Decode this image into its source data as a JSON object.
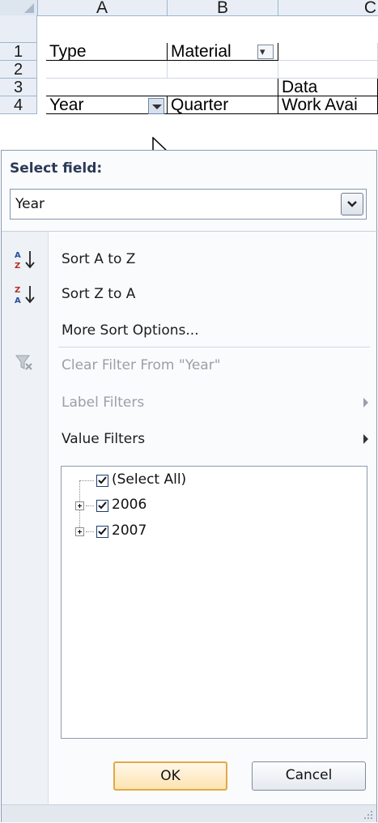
{
  "sheet": {
    "columns": [
      "A",
      "B",
      "C"
    ],
    "rows": [
      "1",
      "2",
      "3",
      "4"
    ],
    "cells": {
      "a1": "Type",
      "b1": "Material",
      "c3": "Data",
      "a4": "Year",
      "b4": "Quarter",
      "c4": "Work Avai"
    }
  },
  "popup": {
    "select_label": "Select field:",
    "select_value": "Year",
    "menu": {
      "sort_az": "Sort A to Z",
      "sort_za": "Sort Z to A",
      "more_sort": "More Sort Options...",
      "clear_filter": "Clear Filter From \"Year\"",
      "label_filters": "Label Filters",
      "value_filters": "Value Filters"
    },
    "tree": [
      {
        "label": "(Select All)",
        "checked": true
      },
      {
        "label": "2006",
        "checked": true
      },
      {
        "label": "2007",
        "checked": true
      }
    ],
    "ok_label": "OK",
    "cancel_label": "Cancel"
  }
}
